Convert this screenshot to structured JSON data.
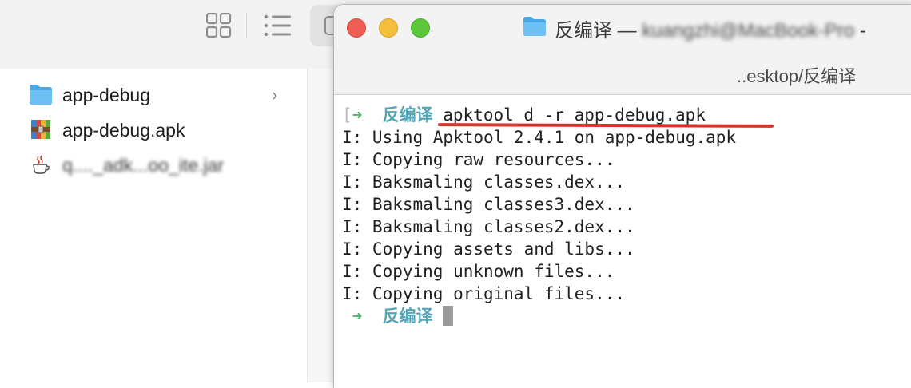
{
  "finder": {
    "files": [
      {
        "name": "app-debug",
        "icon": "folder-icon",
        "has_children": true
      },
      {
        "name": "app-debug.apk",
        "icon": "archive-icon",
        "has_children": false
      },
      {
        "name": "q...._adk...oo_ite.jar",
        "icon": "java-jar-icon",
        "has_children": false
      }
    ],
    "chevron": "›"
  },
  "terminal": {
    "title_prefix": "反编译 — ",
    "title_hostname_blurred": "kuangzhi@MacBook-Pro",
    "title_suffix": " -",
    "path": "..esktop/反编译",
    "lines": [
      {
        "prefix": "[➜",
        "dir": "反编译",
        "text": " apktool d -r app-debug.apk"
      },
      {
        "text": "I: Using Apktool 2.4.1 on app-debug.apk"
      },
      {
        "text": "I: Copying raw resources..."
      },
      {
        "text": "I: Baksmaling classes.dex..."
      },
      {
        "text": "I: Baksmaling classes3.dex..."
      },
      {
        "text": "I: Baksmaling classes2.dex..."
      },
      {
        "text": "I: Copying assets and libs..."
      },
      {
        "text": "I: Copying unknown files..."
      },
      {
        "text": "I: Copying original files..."
      },
      {
        "prefix": " ➜",
        "dir": "反编译",
        "text": " "
      }
    ],
    "colors": {
      "arrow": "#4eb06a",
      "dir": "#54a6b7",
      "underline": "#d1362c"
    }
  }
}
